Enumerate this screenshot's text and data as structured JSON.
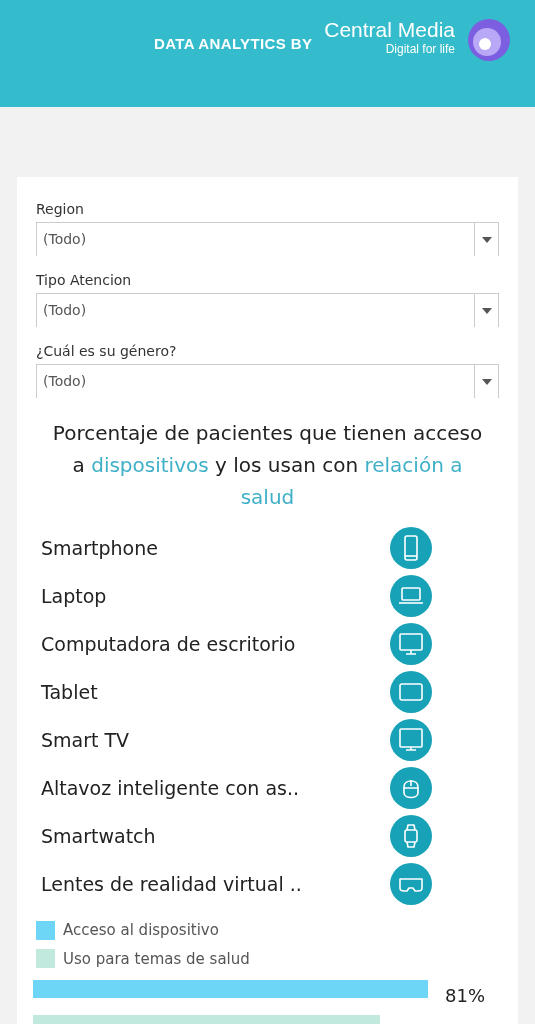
{
  "header": {
    "tagline": "DATA ANALYTICS BY",
    "brand": "Central Media",
    "slogan": "Digital for life"
  },
  "filters": [
    {
      "label": "Region",
      "value": "(Todo)"
    },
    {
      "label": "Tipo Atencion",
      "value": "(Todo)"
    },
    {
      "label": "¿Cuál es su género?",
      "value": "(Todo)"
    }
  ],
  "title": [
    {
      "text": "Porcentaje de pacientes que tienen acceso a ",
      "highlight": false
    },
    {
      "text": "dispositivos",
      "highlight": true
    },
    {
      "text": " y los usan con ",
      "highlight": false
    },
    {
      "text": "relación a salud",
      "highlight": true
    }
  ],
  "devices": [
    {
      "name": "Smartphone",
      "kind": "phone"
    },
    {
      "name": "Laptop",
      "kind": "laptop"
    },
    {
      "name": "Computadora de escritorio",
      "kind": "desktop"
    },
    {
      "name": "Tablet",
      "kind": "tablet"
    },
    {
      "name": "Smart TV",
      "kind": "tv"
    },
    {
      "name": "Altavoz inteligente con as..",
      "kind": "speaker"
    },
    {
      "name": "Smartwatch",
      "kind": "watch"
    },
    {
      "name": "Lentes de realidad virtual ..",
      "kind": "vr"
    }
  ],
  "legend": [
    {
      "label": "Acceso al dispositivo",
      "color": "#6dd5f5"
    },
    {
      "label": "Uso para temas de salud",
      "color": "#c2e9dd"
    }
  ],
  "bar_value": "81%"
}
